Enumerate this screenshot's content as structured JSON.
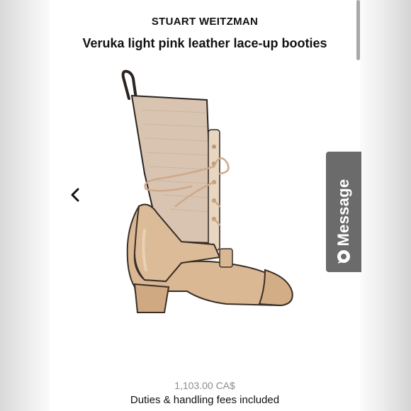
{
  "product": {
    "brand": "STUART WEITZMAN",
    "title": "Veruka light pink leather lace-up booties",
    "price": "1,103.00 CA$",
    "fees_note": "Duties & handling fees included"
  },
  "message_tab": {
    "label": "Message",
    "icon": "chat-bubble-icon"
  },
  "carousel": {
    "prev_icon": "chevron-left-icon"
  },
  "colors": {
    "tab_background": "#6b6b6b",
    "price_text": "#8b8b8b",
    "boot_leather": "#d9b893",
    "boot_knit": "#d8c4b0",
    "boot_trim": "#3a2e26"
  }
}
